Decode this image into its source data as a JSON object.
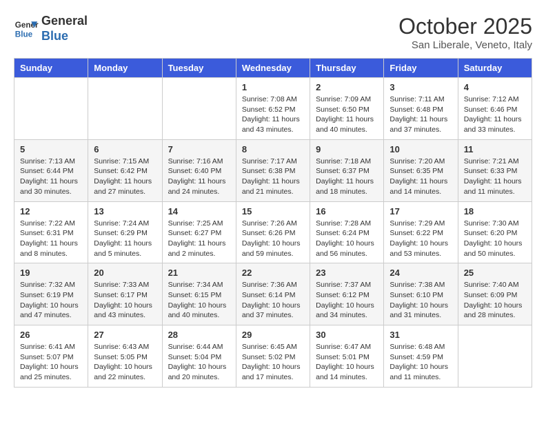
{
  "header": {
    "logo_line1": "General",
    "logo_line2": "Blue",
    "month": "October 2025",
    "location": "San Liberale, Veneto, Italy"
  },
  "weekdays": [
    "Sunday",
    "Monday",
    "Tuesday",
    "Wednesday",
    "Thursday",
    "Friday",
    "Saturday"
  ],
  "weeks": [
    [
      {
        "day": "",
        "info": ""
      },
      {
        "day": "",
        "info": ""
      },
      {
        "day": "",
        "info": ""
      },
      {
        "day": "1",
        "info": "Sunrise: 7:08 AM\nSunset: 6:52 PM\nDaylight: 11 hours and 43 minutes."
      },
      {
        "day": "2",
        "info": "Sunrise: 7:09 AM\nSunset: 6:50 PM\nDaylight: 11 hours and 40 minutes."
      },
      {
        "day": "3",
        "info": "Sunrise: 7:11 AM\nSunset: 6:48 PM\nDaylight: 11 hours and 37 minutes."
      },
      {
        "day": "4",
        "info": "Sunrise: 7:12 AM\nSunset: 6:46 PM\nDaylight: 11 hours and 33 minutes."
      }
    ],
    [
      {
        "day": "5",
        "info": "Sunrise: 7:13 AM\nSunset: 6:44 PM\nDaylight: 11 hours and 30 minutes."
      },
      {
        "day": "6",
        "info": "Sunrise: 7:15 AM\nSunset: 6:42 PM\nDaylight: 11 hours and 27 minutes."
      },
      {
        "day": "7",
        "info": "Sunrise: 7:16 AM\nSunset: 6:40 PM\nDaylight: 11 hours and 24 minutes."
      },
      {
        "day": "8",
        "info": "Sunrise: 7:17 AM\nSunset: 6:38 PM\nDaylight: 11 hours and 21 minutes."
      },
      {
        "day": "9",
        "info": "Sunrise: 7:18 AM\nSunset: 6:37 PM\nDaylight: 11 hours and 18 minutes."
      },
      {
        "day": "10",
        "info": "Sunrise: 7:20 AM\nSunset: 6:35 PM\nDaylight: 11 hours and 14 minutes."
      },
      {
        "day": "11",
        "info": "Sunrise: 7:21 AM\nSunset: 6:33 PM\nDaylight: 11 hours and 11 minutes."
      }
    ],
    [
      {
        "day": "12",
        "info": "Sunrise: 7:22 AM\nSunset: 6:31 PM\nDaylight: 11 hours and 8 minutes."
      },
      {
        "day": "13",
        "info": "Sunrise: 7:24 AM\nSunset: 6:29 PM\nDaylight: 11 hours and 5 minutes."
      },
      {
        "day": "14",
        "info": "Sunrise: 7:25 AM\nSunset: 6:27 PM\nDaylight: 11 hours and 2 minutes."
      },
      {
        "day": "15",
        "info": "Sunrise: 7:26 AM\nSunset: 6:26 PM\nDaylight: 10 hours and 59 minutes."
      },
      {
        "day": "16",
        "info": "Sunrise: 7:28 AM\nSunset: 6:24 PM\nDaylight: 10 hours and 56 minutes."
      },
      {
        "day": "17",
        "info": "Sunrise: 7:29 AM\nSunset: 6:22 PM\nDaylight: 10 hours and 53 minutes."
      },
      {
        "day": "18",
        "info": "Sunrise: 7:30 AM\nSunset: 6:20 PM\nDaylight: 10 hours and 50 minutes."
      }
    ],
    [
      {
        "day": "19",
        "info": "Sunrise: 7:32 AM\nSunset: 6:19 PM\nDaylight: 10 hours and 47 minutes."
      },
      {
        "day": "20",
        "info": "Sunrise: 7:33 AM\nSunset: 6:17 PM\nDaylight: 10 hours and 43 minutes."
      },
      {
        "day": "21",
        "info": "Sunrise: 7:34 AM\nSunset: 6:15 PM\nDaylight: 10 hours and 40 minutes."
      },
      {
        "day": "22",
        "info": "Sunrise: 7:36 AM\nSunset: 6:14 PM\nDaylight: 10 hours and 37 minutes."
      },
      {
        "day": "23",
        "info": "Sunrise: 7:37 AM\nSunset: 6:12 PM\nDaylight: 10 hours and 34 minutes."
      },
      {
        "day": "24",
        "info": "Sunrise: 7:38 AM\nSunset: 6:10 PM\nDaylight: 10 hours and 31 minutes."
      },
      {
        "day": "25",
        "info": "Sunrise: 7:40 AM\nSunset: 6:09 PM\nDaylight: 10 hours and 28 minutes."
      }
    ],
    [
      {
        "day": "26",
        "info": "Sunrise: 6:41 AM\nSunset: 5:07 PM\nDaylight: 10 hours and 25 minutes."
      },
      {
        "day": "27",
        "info": "Sunrise: 6:43 AM\nSunset: 5:05 PM\nDaylight: 10 hours and 22 minutes."
      },
      {
        "day": "28",
        "info": "Sunrise: 6:44 AM\nSunset: 5:04 PM\nDaylight: 10 hours and 20 minutes."
      },
      {
        "day": "29",
        "info": "Sunrise: 6:45 AM\nSunset: 5:02 PM\nDaylight: 10 hours and 17 minutes."
      },
      {
        "day": "30",
        "info": "Sunrise: 6:47 AM\nSunset: 5:01 PM\nDaylight: 10 hours and 14 minutes."
      },
      {
        "day": "31",
        "info": "Sunrise: 6:48 AM\nSunset: 4:59 PM\nDaylight: 10 hours and 11 minutes."
      },
      {
        "day": "",
        "info": ""
      }
    ]
  ]
}
